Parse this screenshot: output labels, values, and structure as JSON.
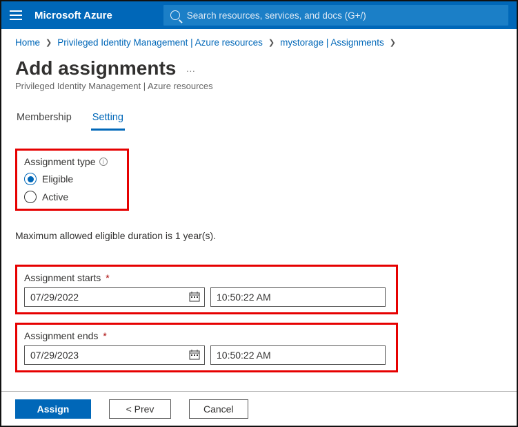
{
  "header": {
    "brand": "Microsoft Azure",
    "search_placeholder": "Search resources, services, and docs (G+/)"
  },
  "breadcrumb": {
    "home": "Home",
    "pim": "Privileged Identity Management | Azure resources",
    "resource": "mystorage | Assignments"
  },
  "page": {
    "title": "Add assignments",
    "subtitle": "Privileged Identity Management | Azure resources"
  },
  "tabs": {
    "membership": "Membership",
    "setting": "Setting"
  },
  "assignment_type": {
    "label": "Assignment type",
    "eligible": "Eligible",
    "active": "Active"
  },
  "duration_text": "Maximum allowed eligible duration is 1 year(s).",
  "starts": {
    "label": "Assignment starts",
    "date": "07/29/2022",
    "time": "10:50:22 AM"
  },
  "ends": {
    "label": "Assignment ends",
    "date": "07/29/2023",
    "time": "10:50:22 AM"
  },
  "footer": {
    "assign": "Assign",
    "prev": "<  Prev",
    "cancel": "Cancel"
  }
}
